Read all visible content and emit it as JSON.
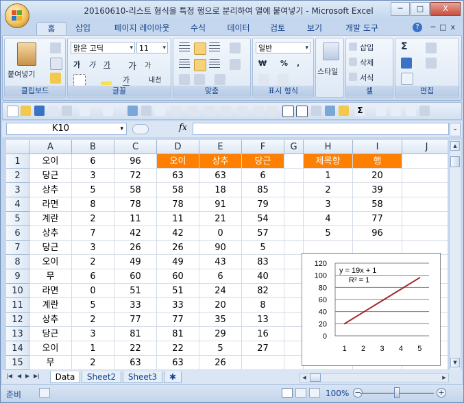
{
  "window": {
    "title": "20160610-리스트 형식을 특정 행으로 분리하여 열에 붙여넣기 - Microsoft Excel",
    "minimize": "─",
    "maximize": "□",
    "close": "X"
  },
  "tabs": [
    {
      "label": "홈"
    },
    {
      "label": "삽입"
    },
    {
      "label": "페이지 레이아웃"
    },
    {
      "label": "수식"
    },
    {
      "label": "데이터"
    },
    {
      "label": "검토"
    },
    {
      "label": "보기"
    },
    {
      "label": "개발 도구"
    }
  ],
  "ribbon": {
    "clipboard": {
      "label": "클립보드",
      "paste": "붙여넣기"
    },
    "font": {
      "label": "글꼴",
      "name": "맑은 고딕",
      "size": "11",
      "bold": "가",
      "italic": "가",
      "underline": "가",
      "grow": "가",
      "shrink": "가",
      "color": "가",
      "phonetic": "내천"
    },
    "alignment": {
      "label": "맞춤"
    },
    "number": {
      "label": "표시 형식",
      "format": "일반",
      "currency": "₩",
      "percent": "%",
      "comma": ","
    },
    "styles": {
      "label": "스타일"
    },
    "cells": {
      "label": "셀",
      "insert": "삽입",
      "delete": "삭제",
      "format": "서식"
    },
    "editing": {
      "label": "편집",
      "sum": "Σ"
    }
  },
  "formula_bar": {
    "name_box": "K10",
    "fx": "fx",
    "formula": ""
  },
  "grid": {
    "columns": [
      "A",
      "B",
      "C",
      "D",
      "E",
      "F",
      "G",
      "H",
      "I",
      "J"
    ],
    "rows": [
      [
        "오이",
        "6",
        "96",
        "오이",
        "상추",
        "당근",
        "",
        "제목항",
        "행",
        ""
      ],
      [
        "당근",
        "3",
        "72",
        "63",
        "63",
        "6",
        "",
        "1",
        "20",
        ""
      ],
      [
        "상추",
        "5",
        "58",
        "58",
        "18",
        "85",
        "",
        "2",
        "39",
        ""
      ],
      [
        "라면",
        "8",
        "78",
        "78",
        "91",
        "79",
        "",
        "3",
        "58",
        ""
      ],
      [
        "계란",
        "2",
        "11",
        "11",
        "21",
        "54",
        "",
        "4",
        "77",
        ""
      ],
      [
        "상추",
        "7",
        "42",
        "42",
        "0",
        "57",
        "",
        "5",
        "96",
        ""
      ],
      [
        "당근",
        "3",
        "26",
        "26",
        "90",
        "5",
        "",
        "",
        "",
        ""
      ],
      [
        "오이",
        "2",
        "49",
        "49",
        "43",
        "83",
        "",
        "",
        "",
        ""
      ],
      [
        "무",
        "6",
        "60",
        "60",
        "6",
        "40",
        "",
        "",
        "",
        ""
      ],
      [
        "라면",
        "0",
        "51",
        "51",
        "24",
        "82",
        "",
        "",
        "",
        ""
      ],
      [
        "계란",
        "5",
        "33",
        "33",
        "20",
        "8",
        "",
        "",
        "",
        ""
      ],
      [
        "상추",
        "2",
        "77",
        "77",
        "35",
        "13",
        "",
        "",
        "",
        ""
      ],
      [
        "당근",
        "3",
        "81",
        "81",
        "29",
        "16",
        "",
        "",
        "",
        ""
      ],
      [
        "오이",
        "1",
        "22",
        "22",
        "5",
        "27",
        "",
        "",
        "",
        ""
      ],
      [
        "무",
        "2",
        "63",
        "63",
        "26",
        "",
        "",
        "",
        "",
        ""
      ]
    ],
    "row_numbers": [
      "1",
      "2",
      "3",
      "4",
      "5",
      "6",
      "7",
      "8",
      "9",
      "10",
      "11",
      "12",
      "13",
      "14",
      "15"
    ],
    "orange_cells": [
      "D1",
      "E1",
      "F1",
      "H1",
      "I1"
    ]
  },
  "chart_data": {
    "type": "line",
    "x": [
      1,
      2,
      3,
      4,
      5
    ],
    "series": [
      {
        "values": [
          20,
          39,
          58,
          77,
          96
        ],
        "color": "#a0282a"
      }
    ],
    "xticks": [
      "1",
      "2",
      "3",
      "4",
      "5"
    ],
    "yticks": [
      "0",
      "20",
      "40",
      "60",
      "80",
      "100",
      "120"
    ],
    "ylim": [
      0,
      120
    ],
    "annotation_equation": "y = 19x + 1",
    "annotation_r2": "R² = 1",
    "grid": "horizontal"
  },
  "sheets": [
    {
      "label": "Data",
      "active": true
    },
    {
      "label": "Sheet2",
      "active": false
    },
    {
      "label": "Sheet3",
      "active": false
    }
  ],
  "status": {
    "ready": "준비",
    "zoom": "100%",
    "zoom_level": 100
  }
}
